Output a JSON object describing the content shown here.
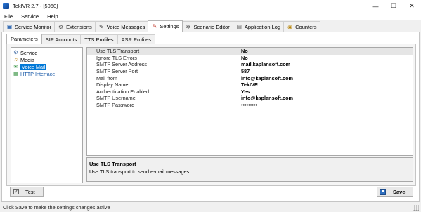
{
  "window": {
    "title": "TekIVR 2.7 - [5060]",
    "minimize": "—",
    "maximize": "☐",
    "close": "✕"
  },
  "menu": [
    "File",
    "Service",
    "Help"
  ],
  "tabs": [
    {
      "label": "Service Monitor",
      "icon": "monitor-icon"
    },
    {
      "label": "Extensions",
      "icon": "extensions-icon"
    },
    {
      "label": "Voice Messages",
      "icon": "voice-messages-icon"
    },
    {
      "label": "Settings",
      "icon": "settings-icon",
      "active": true
    },
    {
      "label": "Scenario Editor",
      "icon": "scenario-editor-icon"
    },
    {
      "label": "Application Log",
      "icon": "log-icon"
    },
    {
      "label": "Counters",
      "icon": "counters-icon"
    }
  ],
  "subtabs": [
    {
      "label": "Parameters",
      "active": true
    },
    {
      "label": "SIP Accounts"
    },
    {
      "label": "TTS Profiles"
    },
    {
      "label": "ASR Profiles"
    }
  ],
  "tree": [
    {
      "label": "Service",
      "icon": "service-icon"
    },
    {
      "label": "Media",
      "icon": "media-icon"
    },
    {
      "label": "Voice Mail",
      "icon": "voice-mail-icon",
      "selected": true
    },
    {
      "label": "HTTP Interface",
      "icon": "http-interface-icon"
    }
  ],
  "properties": [
    {
      "label": "Use TLS Transport",
      "value": "No",
      "selected": true
    },
    {
      "label": "Ignore TLS Errors",
      "value": "No"
    },
    {
      "label": "SMTP Server Address",
      "value": "mail.kaplansoft.com"
    },
    {
      "label": "SMTP Server Port",
      "value": "587"
    },
    {
      "label": "Mail from",
      "value": "info@kaplansoft.com"
    },
    {
      "label": "Display Name",
      "value": "TekIVR"
    },
    {
      "label": "Authentication Enabled",
      "value": "Yes"
    },
    {
      "label": "SMTP Username",
      "value": "info@kaplansoft.com"
    },
    {
      "label": "SMTP Password",
      "value": "•••••••••"
    }
  ],
  "description": {
    "title": "Use TLS Transport",
    "text": "Use TLS transport to send e-mail messages."
  },
  "buttons": {
    "test": "Test",
    "save": "Save"
  },
  "status": "Click Save to make the settings changes active"
}
